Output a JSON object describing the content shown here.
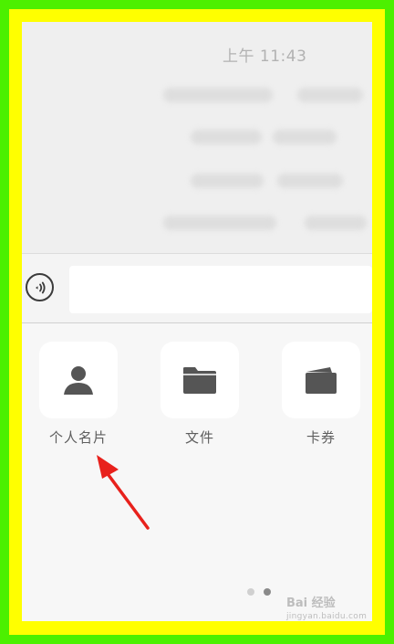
{
  "status_bar": {
    "time": "上午 11:43"
  },
  "input_bar": {
    "voice_icon": "voice-wave-icon",
    "placeholder": ""
  },
  "tools": [
    {
      "label": "个人名片",
      "icon": "person-icon"
    },
    {
      "label": "文件",
      "icon": "folder-icon"
    },
    {
      "label": "卡券",
      "icon": "wallet-icon"
    }
  ],
  "pagination": {
    "total": 2,
    "current": 2
  },
  "annotation": {
    "arrow_color": "#e8211c"
  },
  "watermark": {
    "brand": "Bai 经验",
    "url": "jingyan.baidu.com"
  },
  "colors": {
    "outer_frame": "#4cf000",
    "inner_frame": "#ffff00"
  }
}
